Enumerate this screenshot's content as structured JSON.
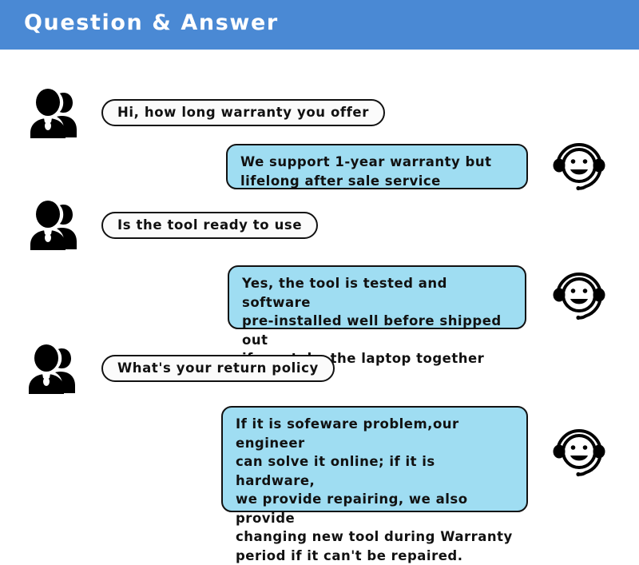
{
  "header": {
    "title": "Question & Answer",
    "background_color": "#4a89d4",
    "text_color": "#ffffff"
  },
  "colors": {
    "page_background": "#ffffff",
    "answer_bubble": "#9fddf2",
    "question_bubble": "#fbfbfb",
    "outline": "#111111"
  },
  "icons": {
    "user": "users-icon",
    "agent": "headset-smiley-icon"
  },
  "conversation": [
    {
      "question": "Hi, how long warranty you offer",
      "answer": "We support 1-year warranty but\nlifelong after sale service"
    },
    {
      "question": "Is the tool ready to use",
      "answer": "Yes, the tool is  tested and software\npre-installed well before shipped out\nif you take the laptop together"
    },
    {
      "question": "What's your return policy",
      "answer": "If it is sofeware problem,our engineer\ncan solve it online; if it is hardware,\nwe provide repairing, we also provide\nchanging new tool during Warranty\nperiod if it can't be repaired."
    }
  ]
}
